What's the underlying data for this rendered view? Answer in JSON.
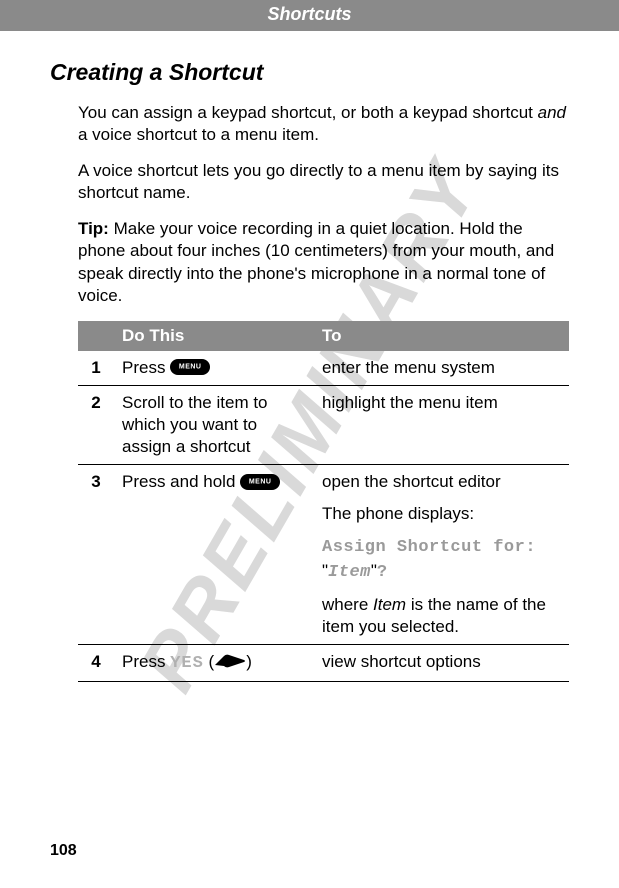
{
  "watermark": "PRELIMINARY",
  "chapter": "Shortcuts",
  "section_title": "Creating a Shortcut",
  "intro": {
    "p1a": "You can assign a keypad shortcut, or both a keypad shortcut ",
    "p1b": "and",
    "p1c": " a voice shortcut to a menu item.",
    "p2": "A voice shortcut lets you go directly to a menu item by saying its shortcut name.",
    "tip_label": "Tip:",
    "tip_body": " Make your voice recording in a quiet location. Hold the phone about four inches (10 centimeters) from your mouth, and speak directly into the phone's microphone in a normal tone of voice."
  },
  "table": {
    "head_do": "Do This",
    "head_to": "To",
    "rows": {
      "r1": {
        "num": "1",
        "do_a": "Press ",
        "to": "enter the menu system"
      },
      "r2": {
        "num": "2",
        "do": "Scroll to the item to which you want to assign a shortcut",
        "to": "highlight the menu item"
      },
      "r3": {
        "num": "3",
        "do_a": "Press and hold ",
        "to_a": "open the shortcut editor",
        "to_b": "The phone displays:",
        "to_c1": "Assign Shortcut for:",
        "to_c2a": "\"",
        "to_c2b": "Item",
        "to_c2c": "\"",
        "to_c2d": "?",
        "to_d1": "where ",
        "to_d2": "Item",
        "to_d3": " is the name of the item you selected."
      },
      "r4": {
        "num": "4",
        "do_a": "Press ",
        "do_yes": "YES",
        "do_b": " (",
        "do_c": ")",
        "to": "view shortcut options"
      }
    }
  },
  "page_number": "108"
}
